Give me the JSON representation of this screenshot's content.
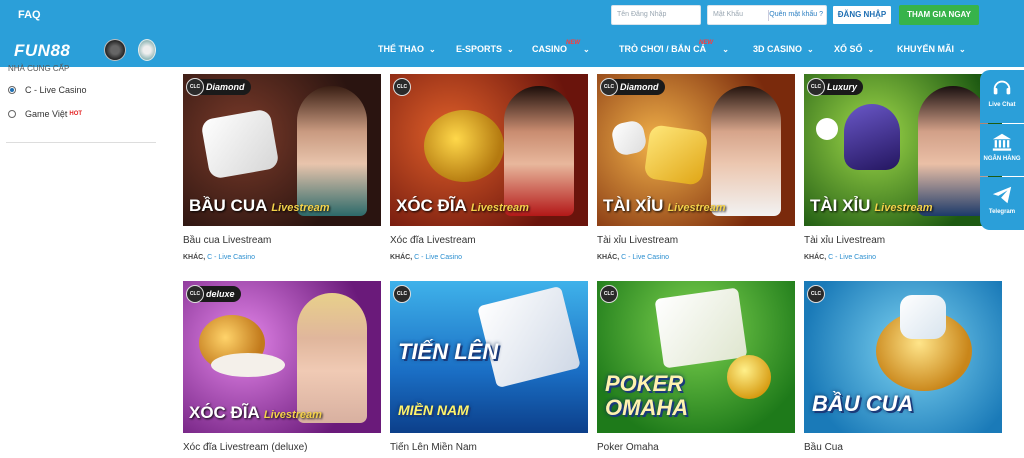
{
  "topbar": {
    "faq": "FAQ",
    "username_placeholder": "Tên Đăng Nhập",
    "password_placeholder": "Mật Khẩu",
    "forgot_password": "Quên mật khẩu ?",
    "login_button": "ĐĂNG NHẬP",
    "join_button": "THAM GIA NGAY"
  },
  "nav": {
    "logo": "FUN88",
    "items": [
      {
        "label": "THỂ THAO",
        "new": ""
      },
      {
        "label": "E-SPORTS",
        "new": ""
      },
      {
        "label": "CASINO",
        "new": "NEW"
      },
      {
        "label": "TRÒ CHƠI / BẮN CÁ",
        "new": "NEW"
      },
      {
        "label": "3D CASINO",
        "new": ""
      },
      {
        "label": "XỔ SỐ",
        "new": ""
      },
      {
        "label": "KHUYẾN MÃI",
        "new": ""
      }
    ]
  },
  "sidebar": {
    "heading": "NHÀ CUNG CẤP",
    "options": [
      {
        "label": "C - Live Casino",
        "selected": true,
        "hot": ""
      },
      {
        "label": "Game Việt",
        "selected": false,
        "hot": "HOT"
      }
    ]
  },
  "games": [
    {
      "name": "Bầu cua Livestream",
      "category": "KHÁC,",
      "provider": "C - Live Casino",
      "badge": "Diamond",
      "art_title": "BẦU CUA",
      "art_sub": "Livestream",
      "clc": "CLC"
    },
    {
      "name": "Xóc đĩa Livestream",
      "category": "KHÁC,",
      "provider": "C - Live Casino",
      "badge": "",
      "art_title": "XÓC ĐĨA",
      "art_sub": "Livestream",
      "clc": "CLC"
    },
    {
      "name": "Tài xỉu Livestream",
      "category": "KHÁC,",
      "provider": "C - Live Casino",
      "badge": "Diamond",
      "art_title": "TÀI XỈU",
      "art_sub": "Livestream",
      "clc": "CLC"
    },
    {
      "name": "Tài xỉu Livestream",
      "category": "KHÁC,",
      "provider": "C - Live Casino",
      "badge": "Luxury",
      "art_title": "TÀI XỈU",
      "art_sub": "Livestream",
      "clc": "CLC"
    },
    {
      "name": "Xóc đĩa Livestream (deluxe)",
      "category": "",
      "provider": "",
      "badge": "deluxe",
      "art_title": "XÓC ĐĨA",
      "art_sub": "Livestream",
      "clc": "CLC"
    },
    {
      "name": "Tiến Lên Miền Nam",
      "category": "",
      "provider": "",
      "badge": "",
      "art_title": "TIẾN LÊN",
      "art_sub": "MIỀN NAM",
      "clc": "CLC"
    },
    {
      "name": "Poker Omaha",
      "category": "",
      "provider": "",
      "badge": "",
      "art_title": "POKER",
      "art_sub": "OMAHA",
      "clc": "CLC"
    },
    {
      "name": "Bầu Cua",
      "category": "",
      "provider": "",
      "badge": "",
      "art_title": "BẦU CUA",
      "art_sub": "",
      "clc": "CLC"
    }
  ],
  "floating": {
    "chat": "Live Chat",
    "bank": "NGÂN HÀNG",
    "telegram": "Telegram"
  },
  "colors": {
    "brand_blue": "#2b9fd9",
    "join_green": "#37b34a",
    "link_blue": "#2b8fd0"
  }
}
